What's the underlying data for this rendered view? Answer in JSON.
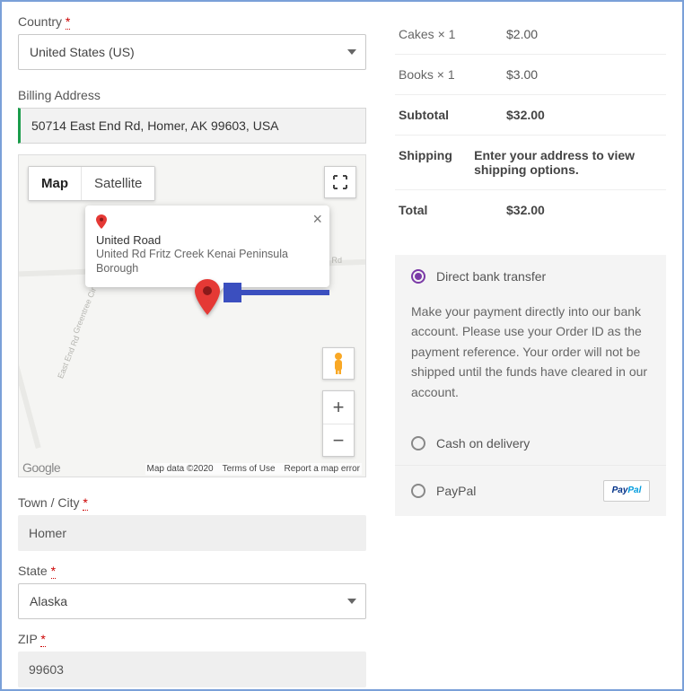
{
  "left": {
    "country_label": "Country",
    "country_value": "United States (US)",
    "billing_label": "Billing Address",
    "billing_value": "50714 East End Rd, Homer, AK 99603, USA",
    "city_label": "Town / City",
    "city_value": "Homer",
    "state_label": "State",
    "state_value": "Alaska",
    "zip_label": "ZIP",
    "zip_value": "99603",
    "required_mark": "*"
  },
  "map": {
    "type_map": "Map",
    "type_satellite": "Satellite",
    "popup_title": "United Road",
    "popup_sub": "United Rd Fritz Creek Kenai Peninsula Borough",
    "road_label_united": "United Rd",
    "road_label_eastend": "East End Rd",
    "road_label_greentree": "Greentree Cir",
    "attr_data": "Map data ©2020",
    "attr_terms": "Terms of Use",
    "attr_report": "Report a map error",
    "google": "Google",
    "zoom_in": "+",
    "zoom_out": "−"
  },
  "summary": {
    "rows": [
      {
        "k": "Cakes × 1",
        "v": "$2.00",
        "strong": false
      },
      {
        "k": "Books × 1",
        "v": "$3.00",
        "strong": false
      },
      {
        "k": "Subtotal",
        "v": "$32.00",
        "strong": true
      },
      {
        "k": "Shipping",
        "v": "Enter your address to view shipping options.",
        "strong": true
      },
      {
        "k": "Total",
        "v": "$32.00",
        "strong": true
      }
    ]
  },
  "payments": {
    "direct": "Direct bank transfer",
    "direct_desc": "Make your payment directly into our bank account. Please use your Order ID as the payment reference. Your order will not be shipped until the funds have cleared in our account.",
    "cod": "Cash on delivery",
    "paypal": "PayPal"
  }
}
